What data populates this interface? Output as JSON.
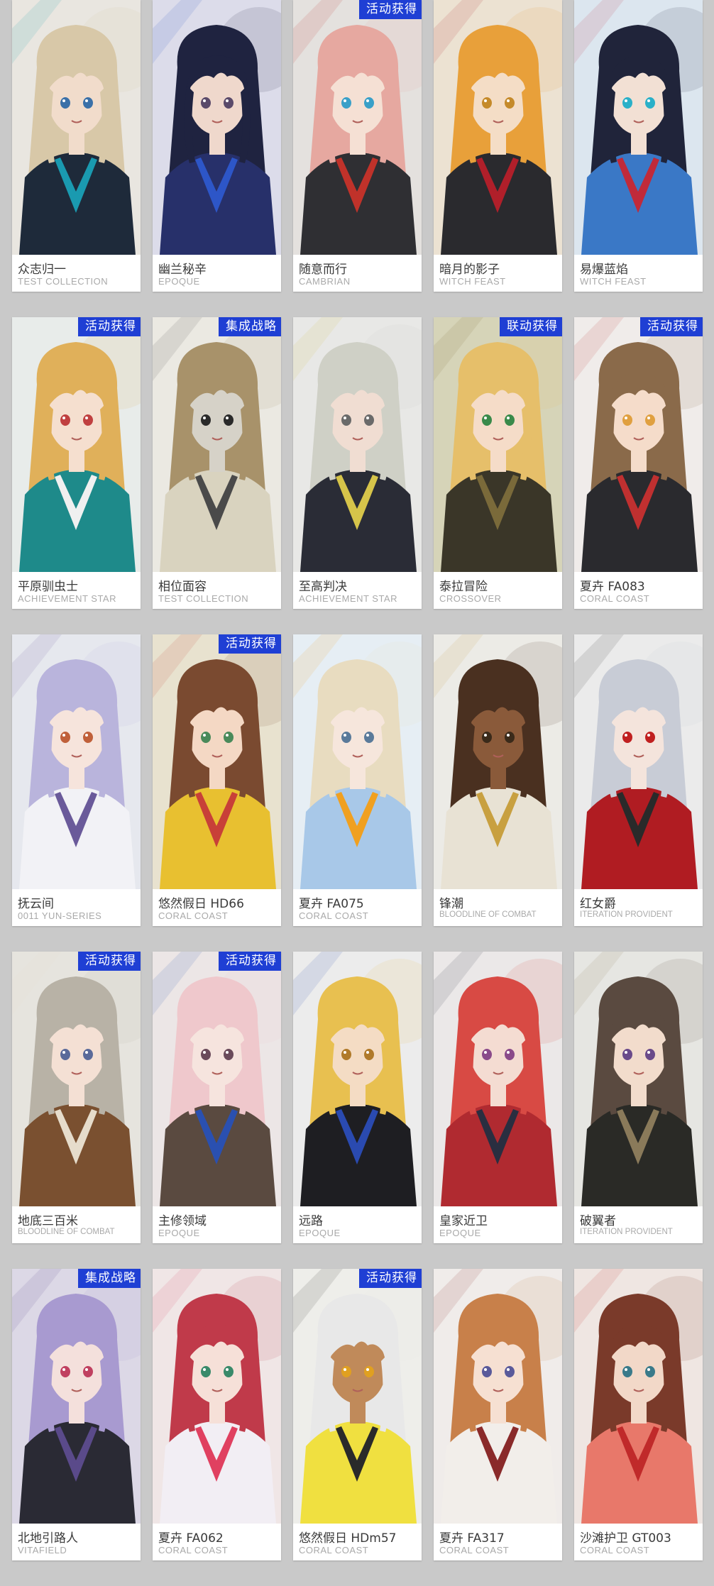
{
  "cards": [
    {
      "name": "众志归一",
      "series": "TEST COLLECTION",
      "tag": "",
      "palette": {
        "bg": "#e9e6e0",
        "hair": "#d8c8a8",
        "skin": "#f1dccb",
        "coat": "#1e2a3a",
        "accent": "#1a9ab0",
        "eye": "#3a70a8"
      }
    },
    {
      "name": "幽兰秘辛",
      "series": "EPOQUE",
      "tag": "",
      "palette": {
        "bg": "#dcdcea",
        "hair": "#1f2340",
        "skin": "#efd8cc",
        "coat": "#27306a",
        "accent": "#2d56c8",
        "eye": "#5a4a6a"
      }
    },
    {
      "name": "随意而行",
      "series": "CAMBRIAN",
      "tag": "活动获得",
      "palette": {
        "bg": "#e4e1de",
        "hair": "#e6a8a0",
        "skin": "#f5e0d4",
        "coat": "#2f2f33",
        "accent": "#c0322a",
        "eye": "#3aa0c8"
      }
    },
    {
      "name": "暗月的影子",
      "series": "WITCH FEAST",
      "tag": "",
      "palette": {
        "bg": "#ece2d2",
        "hair": "#e8a03a",
        "skin": "#f4ddc6",
        "coat": "#2a2a2e",
        "accent": "#b01f2a",
        "eye": "#c58a2a"
      }
    },
    {
      "name": "易爆蓝焰",
      "series": "WITCH FEAST",
      "tag": "",
      "palette": {
        "bg": "#dce6ef",
        "hair": "#20243a",
        "skin": "#f2e0d4",
        "coat": "#3a78c6",
        "accent": "#c02a3a",
        "eye": "#2ab0c8"
      }
    },
    {
      "name": "平原驯虫士",
      "series": "ACHIEVEMENT STAR",
      "tag": "活动获得",
      "palette": {
        "bg": "#e8ecea",
        "hair": "#e0b05a",
        "skin": "#f5dfcf",
        "coat": "#1e8a8a",
        "accent": "#f0f0f0",
        "eye": "#c04040"
      }
    },
    {
      "name": "相位面容",
      "series": "TEST COLLECTION",
      "tag": "集成战略",
      "palette": {
        "bg": "#ebe9e2",
        "hair": "#a8926a",
        "skin": "#d6d2c8",
        "coat": "#d9d3bf",
        "accent": "#4a4a4a",
        "eye": "#2a2a2a"
      }
    },
    {
      "name": "至高判决",
      "series": "ACHIEVEMENT STAR",
      "tag": "",
      "palette": {
        "bg": "#e8e8e6",
        "hair": "#cfd0c6",
        "skin": "#f0ddd2",
        "coat": "#2a2c36",
        "accent": "#d6c44a",
        "eye": "#6a6a6a"
      }
    },
    {
      "name": "泰拉冒险",
      "series": "CROSSOVER",
      "tag": "联动获得",
      "palette": {
        "bg": "#d6d4b8",
        "hair": "#e6bf6a",
        "skin": "#f5dcc8",
        "coat": "#3a3628",
        "accent": "#7a6a3a",
        "eye": "#3a8a4a"
      }
    },
    {
      "name": "夏卉 FA083",
      "series": "CORAL COAST",
      "tag": "活动获得",
      "palette": {
        "bg": "#f0ecea",
        "hair": "#8a6a4a",
        "skin": "#f5dcca",
        "coat": "#2a2a2e",
        "accent": "#c03030",
        "eye": "#e0a040"
      }
    },
    {
      "name": "抚云间",
      "series": "0011 YUN-SERIES",
      "tag": "",
      "palette": {
        "bg": "#e6e8ee",
        "hair": "#b9b4dc",
        "skin": "#f6e4dc",
        "coat": "#f2f2f6",
        "accent": "#6a5a9a",
        "eye": "#c0603a"
      }
    },
    {
      "name": "悠然假日 HD66",
      "series": "CORAL COAST",
      "tag": "活动获得",
      "palette": {
        "bg": "#e8e2cf",
        "hair": "#7a4a30",
        "skin": "#f4d8c4",
        "coat": "#e8c030",
        "accent": "#c84038",
        "eye": "#4a8a5a"
      }
    },
    {
      "name": "夏卉 FA075",
      "series": "CORAL COAST",
      "tag": "",
      "palette": {
        "bg": "#e6eef4",
        "hair": "#e8dcc0",
        "skin": "#f6e6dc",
        "coat": "#a8c8e8",
        "accent": "#f0a020",
        "eye": "#5a7a9a"
      }
    },
    {
      "name": "锋潮",
      "series": "BLOODLINE OF COMBAT",
      "tag": "",
      "palette": {
        "bg": "#ecebe6",
        "hair": "#4a3020",
        "skin": "#8a5a3a",
        "coat": "#e8e2d4",
        "accent": "#c8a040",
        "eye": "#3a2a1a"
      }
    },
    {
      "name": "红女爵",
      "series": "ITERATION PROVIDENT",
      "tag": "",
      "palette": {
        "bg": "#ebebeb",
        "hair": "#c8ccd6",
        "skin": "#f4e4dc",
        "coat": "#b01c22",
        "accent": "#2a2a2a",
        "eye": "#c02020"
      }
    },
    {
      "name": "地底三百米",
      "series": "BLOODLINE OF COMBAT",
      "tag": "活动获得",
      "palette": {
        "bg": "#e6e4de",
        "hair": "#b8b2a6",
        "skin": "#f4e0d4",
        "coat": "#7a5030",
        "accent": "#e6dccb",
        "eye": "#5a6a9a"
      }
    },
    {
      "name": "主修领域",
      "series": "EPOQUE",
      "tag": "活动获得",
      "palette": {
        "bg": "#ece6e6",
        "hair": "#efc8cc",
        "skin": "#f6e4de",
        "coat": "#5a4a40",
        "accent": "#2a50b0",
        "eye": "#6a4a5a"
      }
    },
    {
      "name": "远路",
      "series": "EPOQUE",
      "tag": "",
      "palette": {
        "bg": "#ececec",
        "hair": "#e8c050",
        "skin": "#f4dcc4",
        "coat": "#1e1e22",
        "accent": "#2a4ab0",
        "eye": "#b07a2a"
      }
    },
    {
      "name": "皇家近卫",
      "series": "EPOQUE",
      "tag": "",
      "palette": {
        "bg": "#ebe8e8",
        "hair": "#d84a44",
        "skin": "#f4dcd2",
        "coat": "#b02a30",
        "accent": "#2a2e40",
        "eye": "#8a4a8a"
      }
    },
    {
      "name": "破翼者",
      "series": "ITERATION PROVIDENT",
      "tag": "",
      "palette": {
        "bg": "#e6e6e2",
        "hair": "#5a4a40",
        "skin": "#f2dccc",
        "coat": "#2a2a26",
        "accent": "#8a7a5a",
        "eye": "#6a4a8a"
      }
    },
    {
      "name": "北地引路人",
      "series": "VITAFIELD",
      "tag": "集成战略",
      "palette": {
        "bg": "#dcd8e6",
        "hair": "#a89ad0",
        "skin": "#f4e0dc",
        "coat": "#2a2a34",
        "accent": "#5a4a8a",
        "eye": "#c04060"
      }
    },
    {
      "name": "夏卉 FA062",
      "series": "CORAL COAST",
      "tag": "",
      "palette": {
        "bg": "#f0e6e6",
        "hair": "#c03a4a",
        "skin": "#f6e0d8",
        "coat": "#f2eef4",
        "accent": "#e04060",
        "eye": "#3a8a6a"
      }
    },
    {
      "name": "悠然假日 HDm57",
      "series": "CORAL COAST",
      "tag": "活动获得",
      "palette": {
        "bg": "#eeeeea",
        "hair": "#e8e8e8",
        "skin": "#c08a5a",
        "coat": "#f0e040",
        "accent": "#2a2a2a",
        "eye": "#e0a020"
      }
    },
    {
      "name": "夏卉 FA317",
      "series": "CORAL COAST",
      "tag": "",
      "palette": {
        "bg": "#f0ecea",
        "hair": "#c8804a",
        "skin": "#f6e0d2",
        "coat": "#f2eeea",
        "accent": "#8a2a2a",
        "eye": "#5a5a9a"
      }
    },
    {
      "name": "沙滩护卫 GT003",
      "series": "CORAL COAST",
      "tag": "",
      "palette": {
        "bg": "#efe6e2",
        "hair": "#7a3a2a",
        "skin": "#f2d8c8",
        "coat": "#e8786a",
        "accent": "#c02a2a",
        "eye": "#3a7a8a"
      }
    }
  ]
}
